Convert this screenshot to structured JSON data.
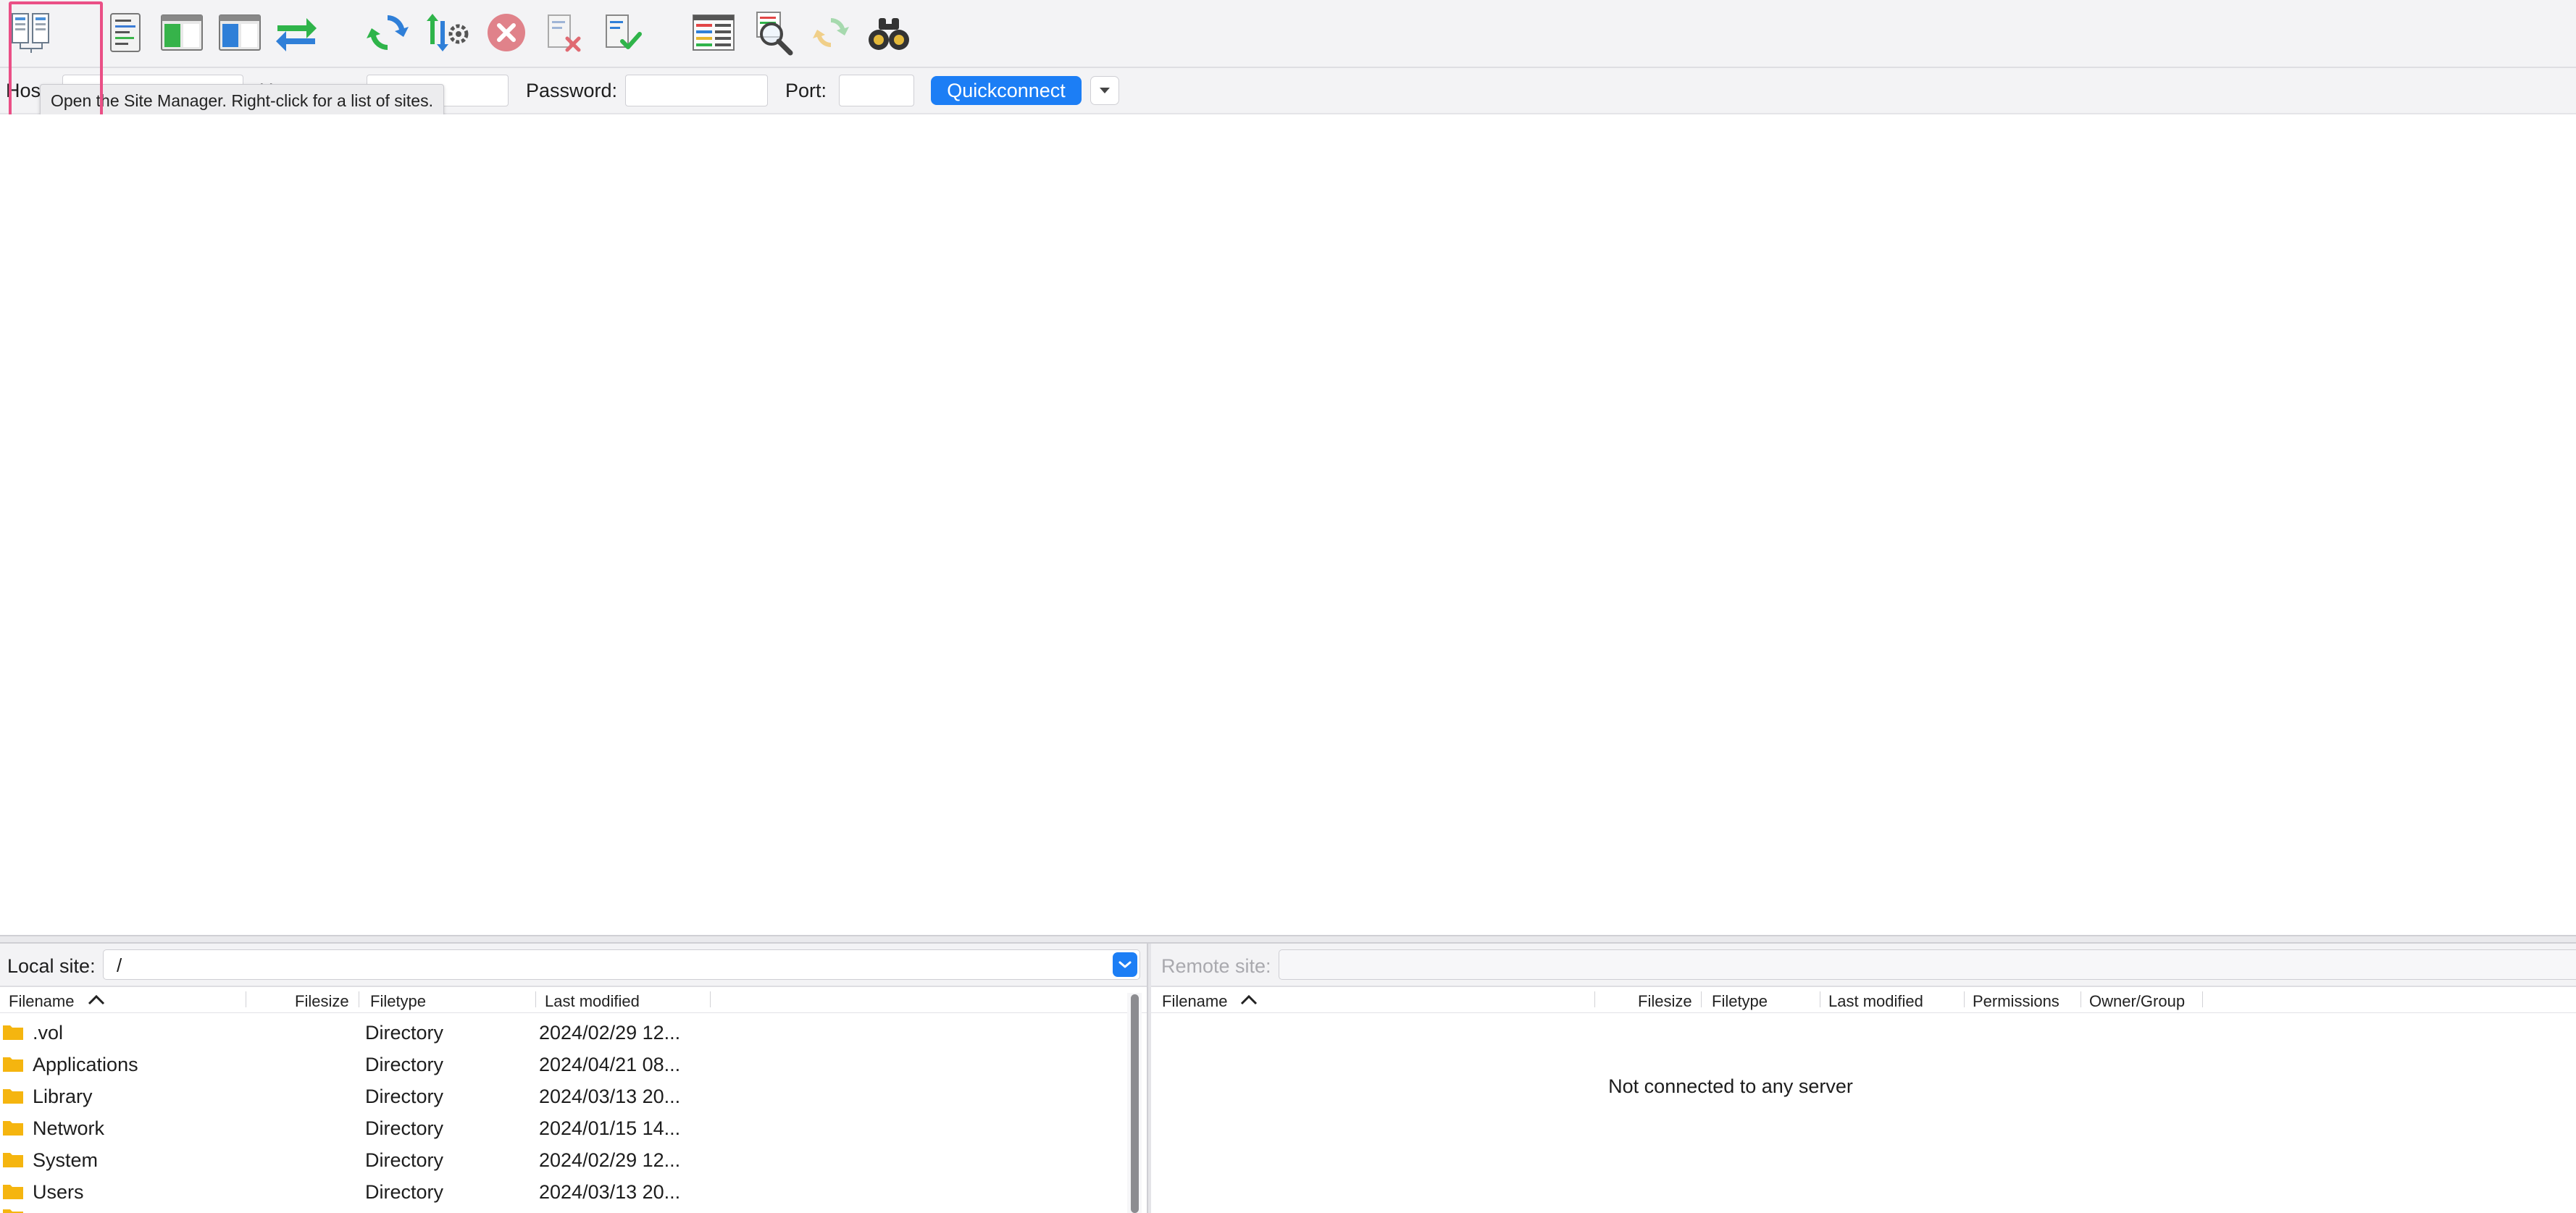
{
  "toolbar": {
    "buttons": [
      {
        "name": "site-manager",
        "icon": "site-manager-icon"
      },
      {
        "name": "toggle-message-log",
        "icon": "message-log-icon"
      },
      {
        "name": "toggle-local-tree",
        "icon": "local-tree-icon"
      },
      {
        "name": "toggle-remote-tree",
        "icon": "remote-tree-icon"
      },
      {
        "name": "toggle-transfer-queue",
        "icon": "transfer-queue-icon"
      },
      {
        "name": "refresh",
        "icon": "refresh-icon"
      },
      {
        "name": "process-queue",
        "icon": "process-queue-icon"
      },
      {
        "name": "cancel",
        "icon": "cancel-icon"
      },
      {
        "name": "disconnect",
        "icon": "disconnect-icon"
      },
      {
        "name": "reconnect",
        "icon": "reconnect-icon"
      },
      {
        "name": "directory-filters",
        "icon": "filter-icon"
      },
      {
        "name": "directory-comparison",
        "icon": "compare-icon"
      },
      {
        "name": "sync-browsing",
        "icon": "sync-browsing-icon"
      },
      {
        "name": "search-remote-files",
        "icon": "binoculars-icon"
      }
    ],
    "tooltip": "Open the Site Manager. Right-click for a list of sites."
  },
  "quickconnect": {
    "host_label": "Host:",
    "username_label": "Username:",
    "password_label": "Password:",
    "port_label": "Port:",
    "host_value": "",
    "username_value": "",
    "password_value": "",
    "port_value": "",
    "button_label": "Quickconnect"
  },
  "local_pane": {
    "site_label": "Local site:",
    "path": "/",
    "columns": [
      "Filename",
      "Filesize",
      "Filetype",
      "Last modified"
    ],
    "rows": [
      {
        "name": ".vol",
        "size": "",
        "type": "Directory",
        "modified": "2024/02/29 12..."
      },
      {
        "name": "Applications",
        "size": "",
        "type": "Directory",
        "modified": "2024/04/21 08..."
      },
      {
        "name": "Library",
        "size": "",
        "type": "Directory",
        "modified": "2024/03/13 20..."
      },
      {
        "name": "Network",
        "size": "",
        "type": "Directory",
        "modified": "2024/01/15 14..."
      },
      {
        "name": "System",
        "size": "",
        "type": "Directory",
        "modified": "2024/02/29 12..."
      },
      {
        "name": "Users",
        "size": "",
        "type": "Directory",
        "modified": "2024/03/13 20..."
      }
    ]
  },
  "remote_pane": {
    "site_label": "Remote site:",
    "path": "",
    "columns": [
      "Filename",
      "Filesize",
      "Filetype",
      "Last modified",
      "Permissions",
      "Owner/Group"
    ],
    "empty_message": "Not connected to any server"
  },
  "colors": {
    "accent": "#1c7ef5",
    "highlight": "#ea4f86"
  }
}
